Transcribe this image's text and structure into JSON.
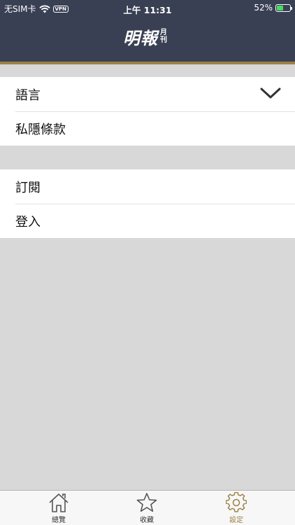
{
  "status_bar": {
    "carrier": "无SIM卡",
    "vpn": "VPN",
    "time": "上午 11:31",
    "battery_percent_label": "52%",
    "battery_level": 0.52
  },
  "header": {
    "logo_main": "明報",
    "logo_sub_top": "月",
    "logo_sub_bottom": "刊"
  },
  "settings": {
    "group1": [
      {
        "label": "語言"
      },
      {
        "label": "私隱條款"
      }
    ],
    "group2": [
      {
        "label": "訂閱"
      },
      {
        "label": "登入"
      }
    ]
  },
  "tabbar": {
    "tabs": [
      {
        "label": "總覽",
        "icon": "home-icon"
      },
      {
        "label": "收藏",
        "icon": "star-icon"
      },
      {
        "label": "設定",
        "icon": "gear-icon"
      }
    ],
    "active_color": "#9c8145"
  },
  "colors": {
    "header_bg": "#3a4054",
    "accent": "#9c8145",
    "page_bg": "#d8d8d8"
  }
}
